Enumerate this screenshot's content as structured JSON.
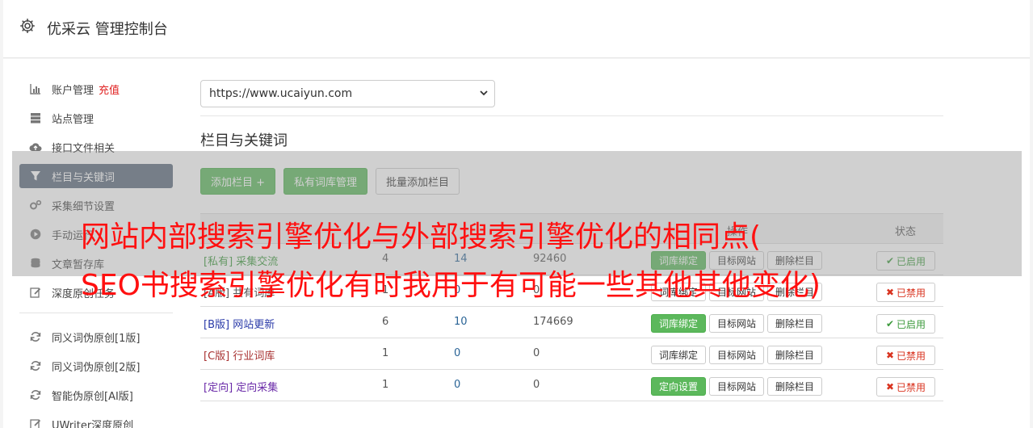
{
  "header": {
    "title": "优采云 管理控制台"
  },
  "sidebar": {
    "items": [
      {
        "label": "账户管理",
        "highlight": "充值",
        "icon": "bar-chart-icon"
      },
      {
        "label": "站点管理",
        "icon": "server-icon"
      },
      {
        "label": "接口文件相关",
        "icon": "cloud-upload-icon"
      },
      {
        "label": "栏目与关键词",
        "icon": "filter-icon",
        "active": true
      },
      {
        "label": "采集细节设置",
        "icon": "cogs-icon"
      },
      {
        "label": "手动运行",
        "icon": "play-circle-icon"
      },
      {
        "label": "文章暂存库",
        "icon": "database-icon"
      },
      {
        "label": "深度原创任务",
        "icon": "edit-icon"
      }
    ],
    "items2": [
      {
        "label": "同义词伪原创[1版]",
        "icon": "refresh-icon"
      },
      {
        "label": "同义词伪原创[2版]",
        "icon": "refresh-icon"
      },
      {
        "label": "智能伪原创[AI版]",
        "icon": "refresh-icon"
      },
      {
        "label": "UWriter深度原创",
        "icon": "edit-icon"
      }
    ]
  },
  "site_select": {
    "value": "https://www.ucaiyun.com"
  },
  "section": {
    "title": "栏目与关键词"
  },
  "toolbar": {
    "add": "添加栏目 +",
    "private": "私有词库管理",
    "batch": "批量添加栏目"
  },
  "table": {
    "headers": {
      "ops": "操作",
      "status": "状态"
    },
    "rows": [
      {
        "tag": "[私有]",
        "name": "采集交流",
        "n1": "4",
        "n2": "14",
        "n3": "92460",
        "op1": "词库绑定",
        "op1_green": true,
        "op2": "目标网站",
        "op3": "删除栏目",
        "status": "已启用",
        "on": true,
        "tagclass": "tag-s"
      },
      {
        "tag": "[A版]",
        "name": "共有词库",
        "n1": "1",
        "n2": "0",
        "n3": "0",
        "op1": "词库绑定",
        "op1_green": false,
        "op2": "目标网站",
        "op3": "删除栏目",
        "status": "已禁用",
        "on": false,
        "tagclass": "tag-a"
      },
      {
        "tag": "[B版]",
        "name": "网站更新",
        "n1": "6",
        "n2": "10",
        "n3": "174669",
        "op1": "词库绑定",
        "op1_green": true,
        "op2": "目标网站",
        "op3": "删除栏目",
        "status": "已启用",
        "on": true,
        "tagclass": "tag-b"
      },
      {
        "tag": "[C版]",
        "name": "行业词库",
        "n1": "1",
        "n2": "0",
        "n3": "0",
        "op1": "词库绑定",
        "op1_green": false,
        "op2": "目标网站",
        "op3": "删除栏目",
        "status": "已禁用",
        "on": false,
        "tagclass": "tag-c"
      },
      {
        "tag": "[定向]",
        "name": "定向采集",
        "n1": "1",
        "n2": "0",
        "n3": "0",
        "op1": "定向设置",
        "op1_green": true,
        "op2": "目标网站",
        "op3": "删除栏目",
        "status": "已禁用",
        "on": false,
        "tagclass": "tag-d"
      }
    ]
  },
  "overlay": {
    "line1": "网站内部搜索引擎优化与外部搜索引擎优化的相同点(",
    "line2": "SEO书搜索引擎优化有时我用于有可能一些其他其他变化)"
  },
  "colors": {
    "accent": "#5cb85c",
    "active_nav": "#5c6b7c",
    "overlay_text": "#ff1010"
  }
}
